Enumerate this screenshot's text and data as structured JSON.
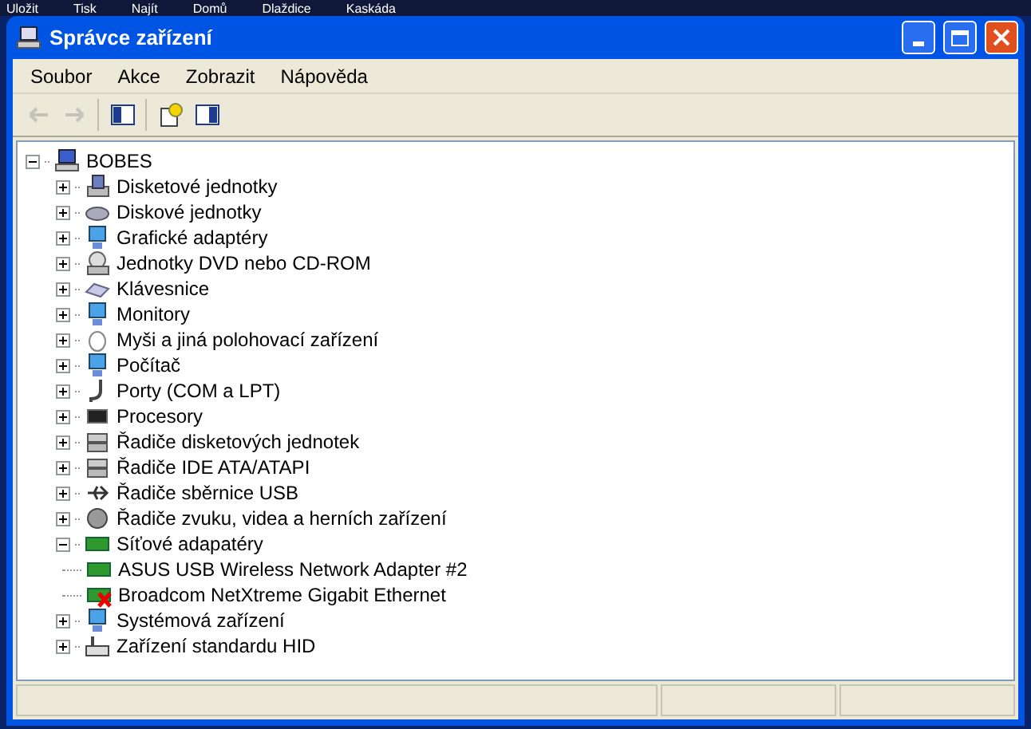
{
  "taskbar": [
    "Uložit",
    "Tisk",
    "Najít",
    "Domů",
    "Dlaždice",
    "Kaskáda"
  ],
  "window": {
    "title": "Správce zařízení"
  },
  "menu": [
    "Soubor",
    "Akce",
    "Zobrazit",
    "Nápověda"
  ],
  "toolbar": [
    {
      "kind": "back",
      "disabled": true
    },
    {
      "kind": "forward",
      "disabled": true
    },
    {
      "kind": "tree",
      "disabled": false
    },
    {
      "kind": "properties",
      "disabled": false
    },
    {
      "kind": "panel",
      "disabled": false
    }
  ],
  "tree": {
    "label": "BOBES",
    "kind": "computer",
    "expanded": true,
    "children": [
      {
        "label": "Disketové jednotky",
        "kind": "floppy",
        "expanded": false
      },
      {
        "label": "Diskové jednotky",
        "kind": "disk",
        "expanded": false
      },
      {
        "label": "Grafické adaptéry",
        "kind": "display",
        "expanded": false
      },
      {
        "label": "Jednotky DVD nebo CD-ROM",
        "kind": "cdrom",
        "expanded": false
      },
      {
        "label": "Klávesnice",
        "kind": "keyboard",
        "expanded": false
      },
      {
        "label": "Monitory",
        "kind": "display",
        "expanded": false
      },
      {
        "label": "Myši a jiná polohovací zařízení",
        "kind": "mouse",
        "expanded": false
      },
      {
        "label": "Počítač",
        "kind": "display",
        "expanded": false
      },
      {
        "label": "Porty (COM a LPT)",
        "kind": "port",
        "expanded": false
      },
      {
        "label": "Procesory",
        "kind": "chip",
        "expanded": false
      },
      {
        "label": "Řadiče disketových jednotek",
        "kind": "controller",
        "expanded": false
      },
      {
        "label": "Řadiče IDE ATA/ATAPI",
        "kind": "controller",
        "expanded": false
      },
      {
        "label": "Řadiče sběrnice USB",
        "kind": "usb",
        "expanded": false
      },
      {
        "label": "Řadiče zvuku, videa a herních zařízení",
        "kind": "sound",
        "expanded": false
      },
      {
        "label": "Síťové adapatéry",
        "kind": "network",
        "expanded": true,
        "children": [
          {
            "label": "ASUS USB Wireless Network Adapter #2",
            "kind": "network",
            "error": false
          },
          {
            "label": "Broadcom NetXtreme Gigabit Ethernet",
            "kind": "network",
            "error": true
          }
        ]
      },
      {
        "label": "Systémová zařízení",
        "kind": "display",
        "expanded": false
      },
      {
        "label": "Zařízení standardu HID",
        "kind": "hid",
        "expanded": false
      }
    ]
  }
}
